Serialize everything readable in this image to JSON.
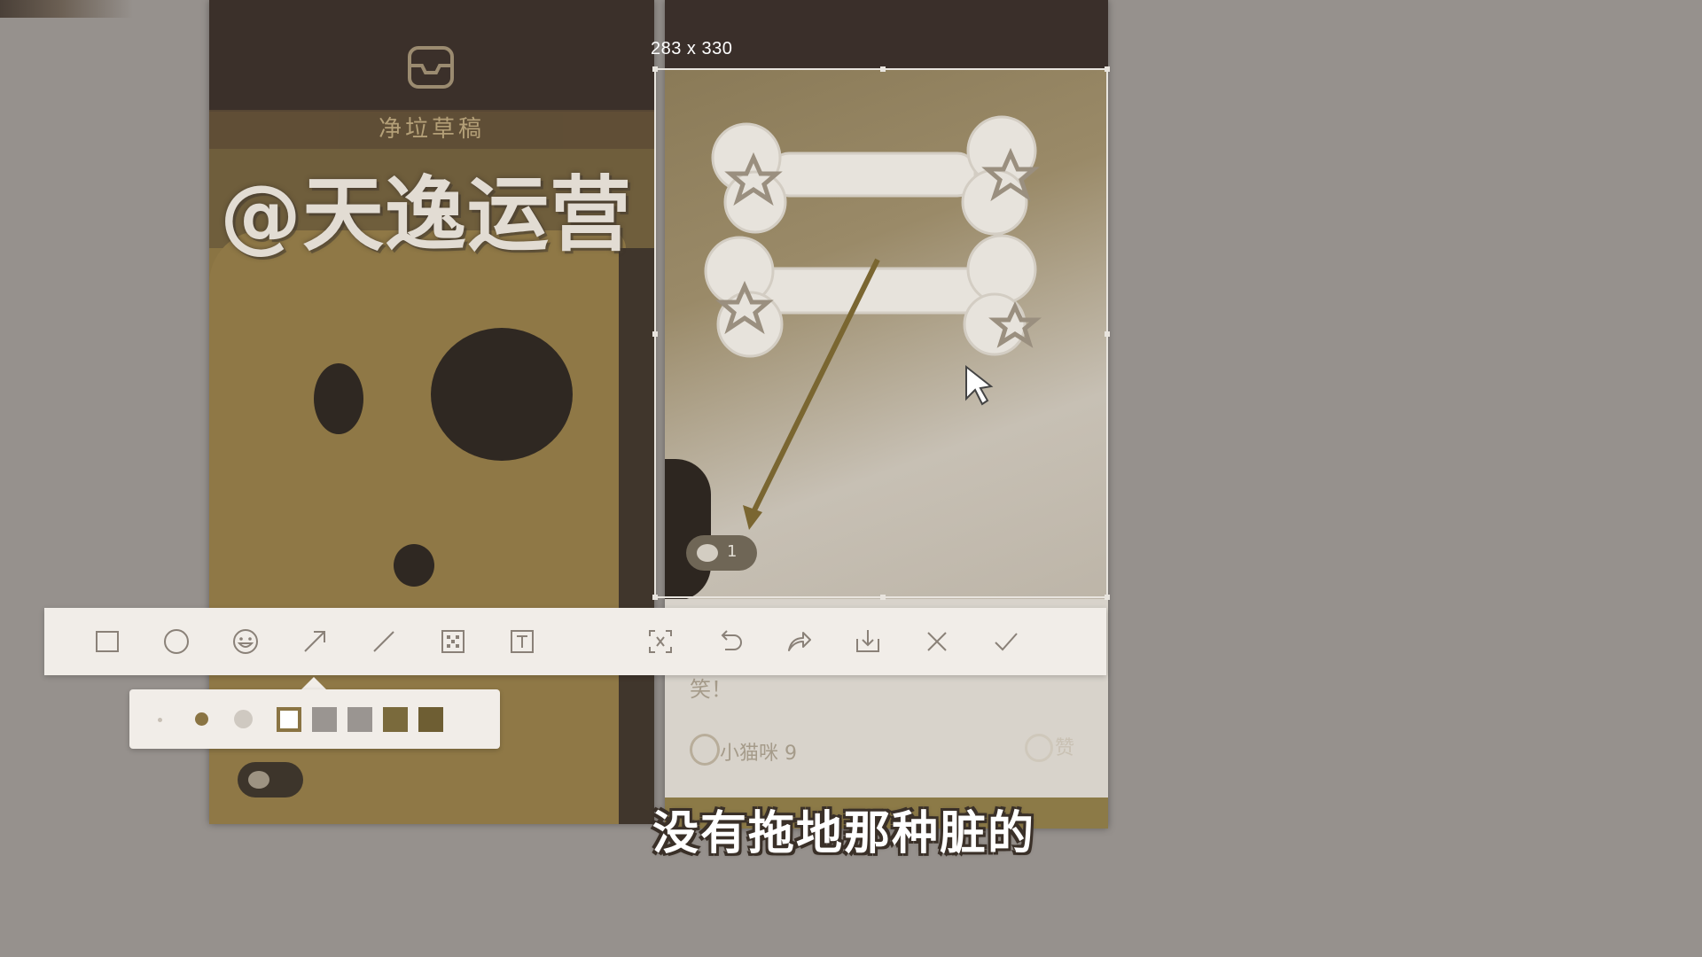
{
  "watermark": "@天逸运营",
  "subtitle": "没有拖地那种脏的",
  "selection": {
    "size_label": "283 x 330"
  },
  "left_screen": {
    "header_label": "净垃草稿"
  },
  "right_screen": {
    "badge_count": "1",
    "caption_text": "笑！",
    "username": "小猫咪 9",
    "like_label": "赞"
  },
  "toolbar": {
    "tools": [
      {
        "name": "rectangle-tool",
        "icon": "rectangle-icon"
      },
      {
        "name": "ellipse-tool",
        "icon": "circle-icon"
      },
      {
        "name": "emoji-tool",
        "icon": "smiley-icon"
      },
      {
        "name": "arrow-tool",
        "icon": "arrow-icon"
      },
      {
        "name": "line-tool",
        "icon": "line-icon"
      },
      {
        "name": "mosaic-tool",
        "icon": "mosaic-icon"
      },
      {
        "name": "text-tool",
        "icon": "text-icon"
      },
      {
        "name": "ocr-tool",
        "icon": "scan-text-icon"
      },
      {
        "name": "undo-button",
        "icon": "undo-icon"
      },
      {
        "name": "share-button",
        "icon": "share-icon"
      },
      {
        "name": "save-button",
        "icon": "download-icon"
      },
      {
        "name": "cancel-button",
        "icon": "close-icon"
      },
      {
        "name": "confirm-button",
        "icon": "check-icon"
      }
    ]
  },
  "color_panel": {
    "stroke_sizes": [
      "small",
      "medium",
      "large"
    ],
    "selected_size": "medium",
    "swatches": [
      "#ffffff",
      "#9a9591",
      "#9a9591",
      "#7a6a3c",
      "#6e5e33"
    ],
    "selected_swatch": 0
  },
  "colors": {
    "accent": "#8a7443",
    "toolbar_bg": "#f1ede8",
    "icon": "#8a8178"
  }
}
